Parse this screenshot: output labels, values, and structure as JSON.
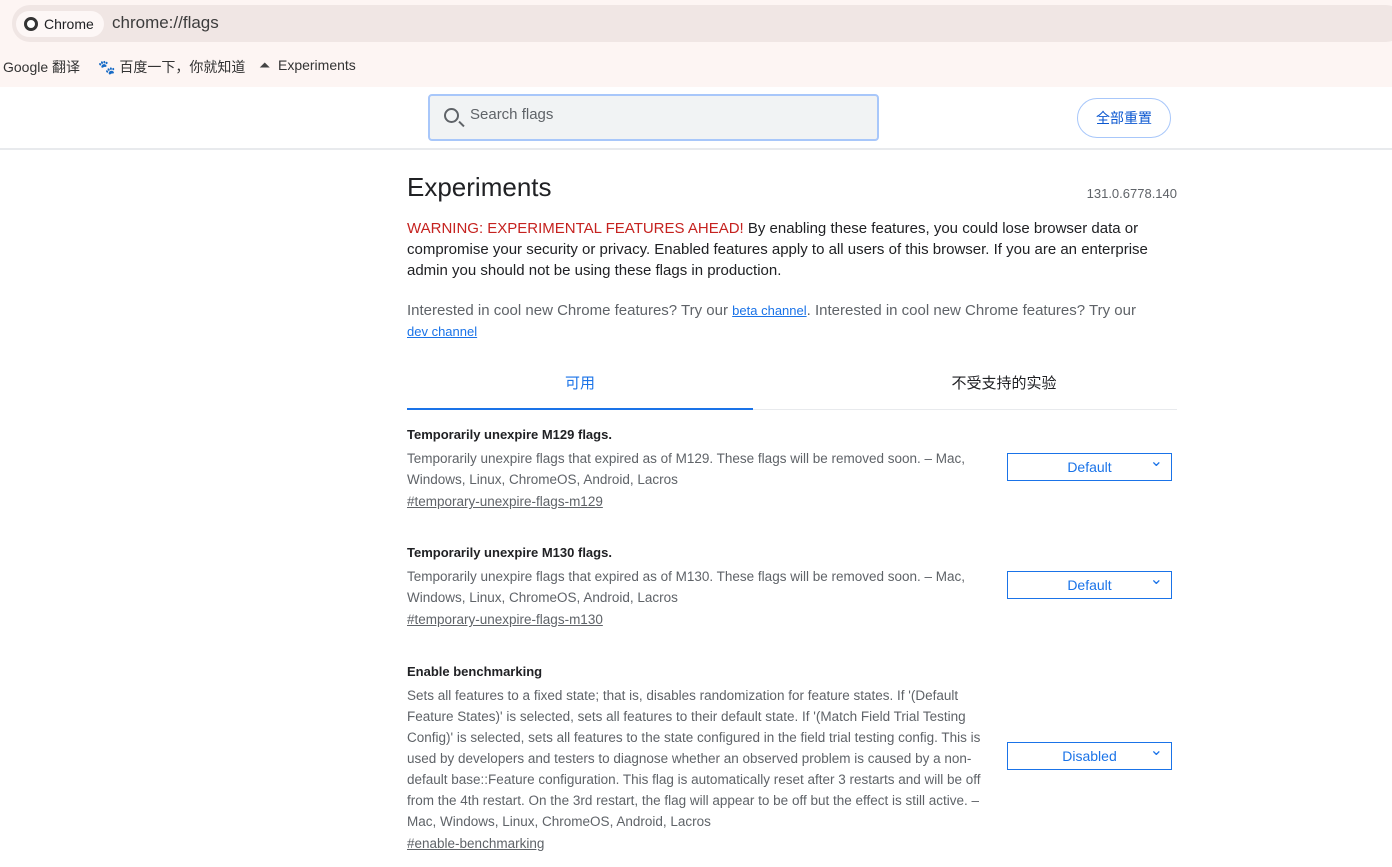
{
  "browser": {
    "chip_label": "Chrome",
    "url": "chrome://flags"
  },
  "bookmarks": [
    {
      "label": "Google 翻译"
    },
    {
      "label": "百度一下，你就知道",
      "icon": "baidu-paw-icon"
    },
    {
      "label": "Experiments",
      "icon": "flask-icon"
    }
  ],
  "header": {
    "search_placeholder": "Search flags",
    "reset_label": "全部重置"
  },
  "main": {
    "title": "Experiments",
    "version": "131.0.6778.140",
    "warning_red": "WARNING: EXPERIMENTAL FEATURES AHEAD!",
    "warning_text": " By enabling these features, you could lose browser data or compromise your security or privacy. Enabled features apply to all users of this browser. If you are an enterprise admin you should not be using these flags in production.",
    "interest_1": "Interested in cool new Chrome features? Try our ",
    "beta_link": "beta channel",
    "interest_2": ". Interested in cool new Chrome features? Try our ",
    "dev_link": "dev channel",
    "tabs": [
      {
        "label": "可用",
        "active": true
      },
      {
        "label": "不受支持的实验",
        "active": false
      }
    ],
    "flags": [
      {
        "title": "Temporarily unexpire M129 flags.",
        "desc": "Temporarily unexpire flags that expired as of M129. These flags will be removed soon. – Mac, Windows, Linux, ChromeOS, Android, Lacros",
        "link": "#temporary-unexpire-flags-m129",
        "value": "Default"
      },
      {
        "title": "Temporarily unexpire M130 flags.",
        "desc": "Temporarily unexpire flags that expired as of M130. These flags will be removed soon. – Mac, Windows, Linux, ChromeOS, Android, Lacros",
        "link": "#temporary-unexpire-flags-m130",
        "value": "Default"
      },
      {
        "title": "Enable benchmarking",
        "desc": "Sets all features to a fixed state; that is, disables randomization for feature states. If '(Default Feature States)' is selected, sets all features to their default state. If '(Match Field Trial Testing Config)' is selected, sets all features to the state configured in the field trial testing config. This is used by developers and testers to diagnose whether an observed problem is caused by a non-default base::Feature configuration. This flag is automatically reset after 3 restarts and will be off from the 4th restart. On the 3rd restart, the flag will appear to be off but the effect is still active. – Mac, Windows, Linux, ChromeOS, Android, Lacros",
        "link": "#enable-benchmarking",
        "value": "Disabled"
      }
    ]
  },
  "colors": {
    "accent": "#1a73e8",
    "warning": "#c5221f"
  }
}
